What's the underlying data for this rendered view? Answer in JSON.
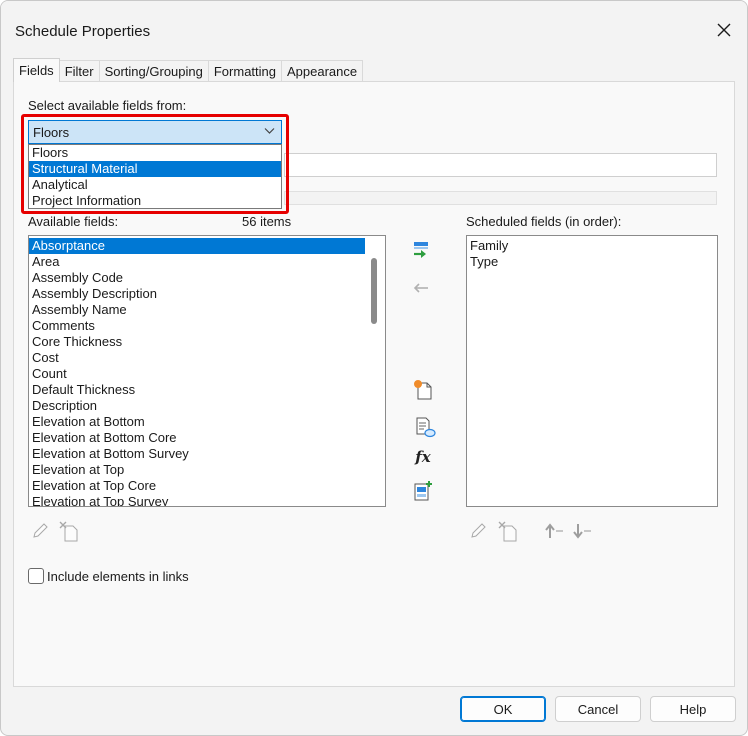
{
  "window": {
    "title": "Schedule Properties"
  },
  "tabs": [
    {
      "label": "Fields",
      "active": true
    },
    {
      "label": "Filter",
      "active": false
    },
    {
      "label": "Sorting/Grouping",
      "active": false
    },
    {
      "label": "Formatting",
      "active": false
    },
    {
      "label": "Appearance",
      "active": false
    }
  ],
  "select_from": {
    "label": "Select available fields from:",
    "selected": "Floors",
    "options": [
      "Floors",
      "Structural Material",
      "Analytical",
      "Project Information"
    ],
    "highlighted_option": "Structural Material"
  },
  "available": {
    "label": "Available fields:",
    "count_text": "56 items",
    "items": [
      "Absorptance",
      "Area",
      "Assembly Code",
      "Assembly Description",
      "Assembly Name",
      "Comments",
      "Core Thickness",
      "Cost",
      "Count",
      "Default Thickness",
      "Description",
      "Elevation at Bottom",
      "Elevation at Bottom Core",
      "Elevation at Bottom Survey",
      "Elevation at Top",
      "Elevation at Top Core",
      "Elevation at Top Survey"
    ],
    "selected": "Absorptance"
  },
  "scheduled": {
    "label": "Scheduled fields (in order):",
    "items": [
      "Family",
      "Type"
    ]
  },
  "icons": {
    "add": "add-field-icon",
    "remove": "remove-field-icon",
    "new_parameter": "new-parameter-icon",
    "calculated": "calculated-value-icon",
    "formula": "fx-icon",
    "combine": "combine-parameters-icon",
    "edit": "edit-pencil-icon",
    "delete": "delete-parameter-icon",
    "move_up": "move-up-icon",
    "move_down": "move-down-icon"
  },
  "formula_glyph": "fx",
  "include_links": {
    "label": "Include elements in links",
    "checked": false
  },
  "buttons": {
    "ok": "OK",
    "cancel": "Cancel",
    "help": "Help"
  },
  "colors": {
    "accent": "#0078d4",
    "highlight_border": "#e60000",
    "selection_bg": "#0078d4"
  }
}
